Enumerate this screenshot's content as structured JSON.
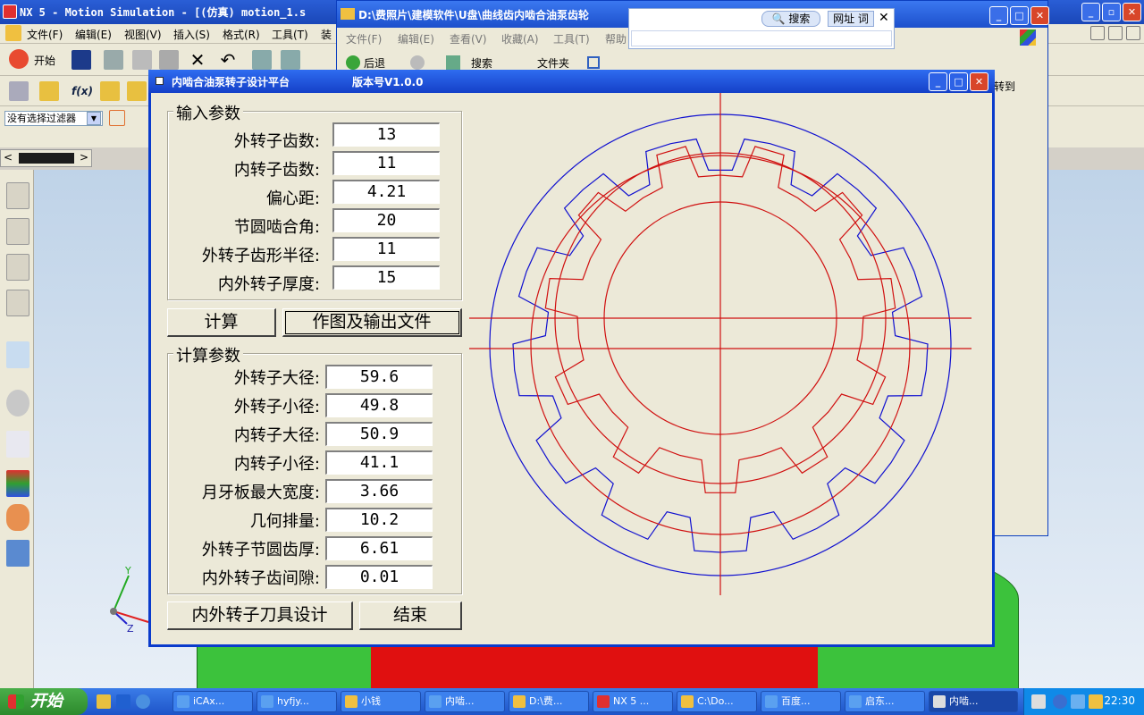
{
  "nx": {
    "title": "NX 5 - Motion Simulation - [(仿真) motion_1.s",
    "menu": [
      "文件(F)",
      "编辑(E)",
      "视图(V)",
      "插入(S)",
      "格式(R)",
      "工具(T)",
      "装"
    ],
    "start_label": "开始",
    "filter_label": "没有选择过滤器",
    "axis_y": "Y",
    "axis_z": "Z"
  },
  "explorer": {
    "title": "D:\\费照片\\建模软件\\U盘\\曲线齿内啮合油泵齿轮",
    "menu": [
      "文件(F)",
      "编辑(E)",
      "查看(V)",
      "收藏(A)",
      "工具(T)",
      "帮助"
    ],
    "back_label": "后退",
    "search_label": "搜索",
    "folder_label": "文件夹",
    "goto_label": "转到"
  },
  "search_popup": {
    "search_label": "搜索",
    "url_label": "网址 词"
  },
  "dialog": {
    "title": "内啮合油泵转子设计平台",
    "version": "版本号V1.0.0",
    "input_group_title": "输入参数",
    "inputs": [
      {
        "label": "外转子齿数:",
        "value": "13"
      },
      {
        "label": "内转子齿数:",
        "value": "11"
      },
      {
        "label": "偏心距:",
        "value": "4.21"
      },
      {
        "label": "节圆啮合角:",
        "value": "20"
      },
      {
        "label": "外转子齿形半径:",
        "value": "11"
      },
      {
        "label": "内外转子厚度:",
        "value": "15"
      }
    ],
    "calc_button": "计算",
    "draw_button": "作图及输出文件",
    "calc_group_title": "计算参数",
    "outputs": [
      {
        "label": "外转子大径:",
        "value": "59.6"
      },
      {
        "label": "外转子小径:",
        "value": "49.8"
      },
      {
        "label": "内转子大径:",
        "value": "50.9"
      },
      {
        "label": "内转子小径:",
        "value": "41.1"
      },
      {
        "label": "月牙板最大宽度:",
        "value": "3.66"
      },
      {
        "label": "几何排量:",
        "value": "10.2"
      },
      {
        "label": "外转子节圆齿厚:",
        "value": "6.61"
      },
      {
        "label": "内外转子齿间隙:",
        "value": "0.01"
      }
    ],
    "tool_button": "内外转子刀具设计",
    "end_button": "结束",
    "colors": {
      "outer_rotor": "#1010d0",
      "inner_rotor": "#d01010"
    }
  },
  "taskbar": {
    "start": "开始",
    "tasks": [
      "iCAx...",
      "hyfjy...",
      "小钱",
      "内啮...",
      "D:\\费...",
      "NX 5 ...",
      "C:\\Do...",
      "百度...",
      "启东...",
      "内啮..."
    ],
    "clock": "22:30"
  }
}
